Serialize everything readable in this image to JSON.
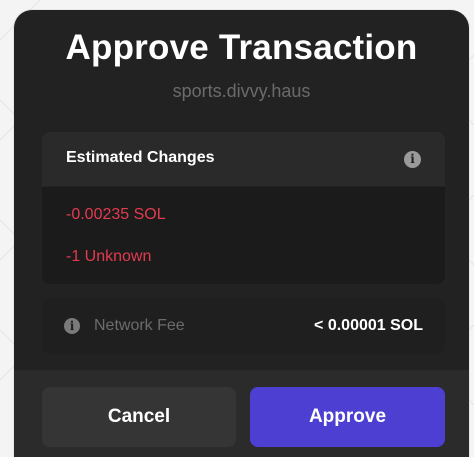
{
  "dialog": {
    "title": "Approve Transaction",
    "origin": "sports.divvy.haus"
  },
  "estimated_changes": {
    "title": "Estimated Changes",
    "info_icon": "info-icon",
    "items": [
      "-0.00235 SOL",
      "-1 Unknown"
    ],
    "negative_color": "#e23b4f"
  },
  "network_fee": {
    "info_icon": "info-icon",
    "label": "Network Fee",
    "value": "< 0.00001 SOL"
  },
  "actions": {
    "cancel_label": "Cancel",
    "approve_label": "Approve",
    "approve_color": "#4c3fd1"
  }
}
